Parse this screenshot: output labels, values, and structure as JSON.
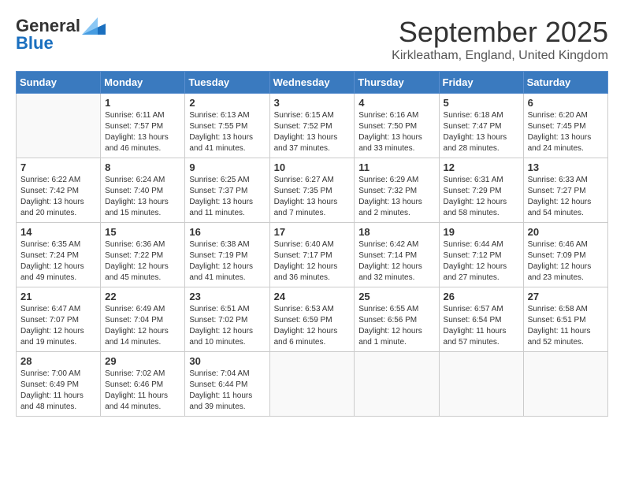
{
  "logo": {
    "general": "General",
    "blue": "Blue"
  },
  "title": "September 2025",
  "subtitle": "Kirkleatham, England, United Kingdom",
  "days_of_week": [
    "Sunday",
    "Monday",
    "Tuesday",
    "Wednesday",
    "Thursday",
    "Friday",
    "Saturday"
  ],
  "weeks": [
    [
      {
        "day": "",
        "info": ""
      },
      {
        "day": "1",
        "info": "Sunrise: 6:11 AM\nSunset: 7:57 PM\nDaylight: 13 hours and 46 minutes."
      },
      {
        "day": "2",
        "info": "Sunrise: 6:13 AM\nSunset: 7:55 PM\nDaylight: 13 hours and 41 minutes."
      },
      {
        "day": "3",
        "info": "Sunrise: 6:15 AM\nSunset: 7:52 PM\nDaylight: 13 hours and 37 minutes."
      },
      {
        "day": "4",
        "info": "Sunrise: 6:16 AM\nSunset: 7:50 PM\nDaylight: 13 hours and 33 minutes."
      },
      {
        "day": "5",
        "info": "Sunrise: 6:18 AM\nSunset: 7:47 PM\nDaylight: 13 hours and 28 minutes."
      },
      {
        "day": "6",
        "info": "Sunrise: 6:20 AM\nSunset: 7:45 PM\nDaylight: 13 hours and 24 minutes."
      }
    ],
    [
      {
        "day": "7",
        "info": "Sunrise: 6:22 AM\nSunset: 7:42 PM\nDaylight: 13 hours and 20 minutes."
      },
      {
        "day": "8",
        "info": "Sunrise: 6:24 AM\nSunset: 7:40 PM\nDaylight: 13 hours and 15 minutes."
      },
      {
        "day": "9",
        "info": "Sunrise: 6:25 AM\nSunset: 7:37 PM\nDaylight: 13 hours and 11 minutes."
      },
      {
        "day": "10",
        "info": "Sunrise: 6:27 AM\nSunset: 7:35 PM\nDaylight: 13 hours and 7 minutes."
      },
      {
        "day": "11",
        "info": "Sunrise: 6:29 AM\nSunset: 7:32 PM\nDaylight: 13 hours and 2 minutes."
      },
      {
        "day": "12",
        "info": "Sunrise: 6:31 AM\nSunset: 7:29 PM\nDaylight: 12 hours and 58 minutes."
      },
      {
        "day": "13",
        "info": "Sunrise: 6:33 AM\nSunset: 7:27 PM\nDaylight: 12 hours and 54 minutes."
      }
    ],
    [
      {
        "day": "14",
        "info": "Sunrise: 6:35 AM\nSunset: 7:24 PM\nDaylight: 12 hours and 49 minutes."
      },
      {
        "day": "15",
        "info": "Sunrise: 6:36 AM\nSunset: 7:22 PM\nDaylight: 12 hours and 45 minutes."
      },
      {
        "day": "16",
        "info": "Sunrise: 6:38 AM\nSunset: 7:19 PM\nDaylight: 12 hours and 41 minutes."
      },
      {
        "day": "17",
        "info": "Sunrise: 6:40 AM\nSunset: 7:17 PM\nDaylight: 12 hours and 36 minutes."
      },
      {
        "day": "18",
        "info": "Sunrise: 6:42 AM\nSunset: 7:14 PM\nDaylight: 12 hours and 32 minutes."
      },
      {
        "day": "19",
        "info": "Sunrise: 6:44 AM\nSunset: 7:12 PM\nDaylight: 12 hours and 27 minutes."
      },
      {
        "day": "20",
        "info": "Sunrise: 6:46 AM\nSunset: 7:09 PM\nDaylight: 12 hours and 23 minutes."
      }
    ],
    [
      {
        "day": "21",
        "info": "Sunrise: 6:47 AM\nSunset: 7:07 PM\nDaylight: 12 hours and 19 minutes."
      },
      {
        "day": "22",
        "info": "Sunrise: 6:49 AM\nSunset: 7:04 PM\nDaylight: 12 hours and 14 minutes."
      },
      {
        "day": "23",
        "info": "Sunrise: 6:51 AM\nSunset: 7:02 PM\nDaylight: 12 hours and 10 minutes."
      },
      {
        "day": "24",
        "info": "Sunrise: 6:53 AM\nSunset: 6:59 PM\nDaylight: 12 hours and 6 minutes."
      },
      {
        "day": "25",
        "info": "Sunrise: 6:55 AM\nSunset: 6:56 PM\nDaylight: 12 hours and 1 minute."
      },
      {
        "day": "26",
        "info": "Sunrise: 6:57 AM\nSunset: 6:54 PM\nDaylight: 11 hours and 57 minutes."
      },
      {
        "day": "27",
        "info": "Sunrise: 6:58 AM\nSunset: 6:51 PM\nDaylight: 11 hours and 52 minutes."
      }
    ],
    [
      {
        "day": "28",
        "info": "Sunrise: 7:00 AM\nSunset: 6:49 PM\nDaylight: 11 hours and 48 minutes."
      },
      {
        "day": "29",
        "info": "Sunrise: 7:02 AM\nSunset: 6:46 PM\nDaylight: 11 hours and 44 minutes."
      },
      {
        "day": "30",
        "info": "Sunrise: 7:04 AM\nSunset: 6:44 PM\nDaylight: 11 hours and 39 minutes."
      },
      {
        "day": "",
        "info": ""
      },
      {
        "day": "",
        "info": ""
      },
      {
        "day": "",
        "info": ""
      },
      {
        "day": "",
        "info": ""
      }
    ]
  ]
}
